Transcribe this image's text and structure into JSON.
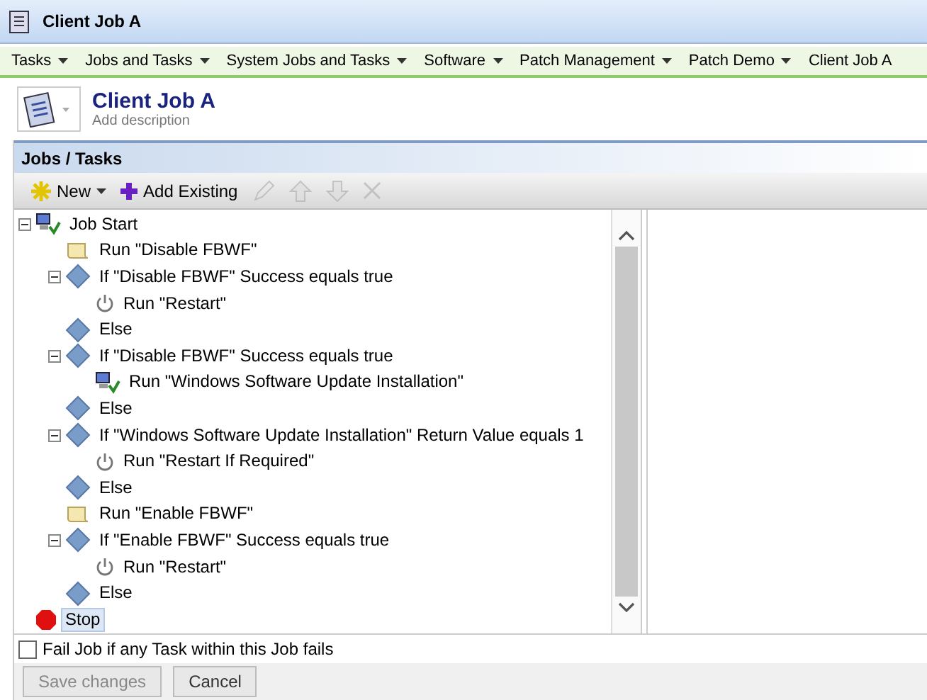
{
  "window": {
    "title": "Client Job A"
  },
  "menu": [
    {
      "label": "Tasks",
      "dropdown": true
    },
    {
      "label": "Jobs and Tasks",
      "dropdown": true
    },
    {
      "label": "System Jobs and Tasks",
      "dropdown": true
    },
    {
      "label": "Software",
      "dropdown": true
    },
    {
      "label": "Patch Management",
      "dropdown": true
    },
    {
      "label": "Patch Demo",
      "dropdown": true
    },
    {
      "label": "Client Job A",
      "dropdown": false
    }
  ],
  "header": {
    "title": "Client Job A",
    "description": "Add description"
  },
  "panel": {
    "title": "Jobs / Tasks"
  },
  "toolbar": [
    {
      "kind": "new",
      "label": "New",
      "disabled": false
    },
    {
      "kind": "add",
      "label": "Add Existing",
      "disabled": false
    },
    {
      "kind": "edit",
      "disabled": true
    },
    {
      "kind": "up",
      "disabled": true
    },
    {
      "kind": "down",
      "disabled": true
    },
    {
      "kind": "delete",
      "disabled": true
    }
  ],
  "tree": [
    {
      "kind": "job",
      "label": "Job Start",
      "selected": false,
      "expanded": true,
      "children": [
        {
          "kind": "script",
          "label": "Run \"Disable FBWF\"",
          "selected": false
        },
        {
          "kind": "condition",
          "label": "If \"Disable FBWF\" Success equals true",
          "selected": false,
          "expanded": true,
          "children": [
            {
              "kind": "power",
              "label": "Run \"Restart\"",
              "selected": false
            }
          ]
        },
        {
          "kind": "condition",
          "label": "Else",
          "selected": false
        },
        {
          "kind": "condition",
          "label": "If \"Disable FBWF\" Success equals true",
          "selected": false,
          "expanded": true,
          "children": [
            {
              "kind": "job",
              "label": "Run \"Windows Software Update Installation\"",
              "selected": false
            }
          ]
        },
        {
          "kind": "condition",
          "label": "Else",
          "selected": false
        },
        {
          "kind": "condition",
          "label": "If \"Windows Software Update Installation\" Return Value equals 1",
          "selected": false,
          "expanded": true,
          "children": [
            {
              "kind": "power",
              "label": "Run \"Restart If Required\"",
              "selected": false
            }
          ]
        },
        {
          "kind": "condition",
          "label": "Else",
          "selected": false
        },
        {
          "kind": "script",
          "label": "Run \"Enable FBWF\"",
          "selected": false
        },
        {
          "kind": "condition",
          "label": "If \"Enable FBWF\" Success equals true",
          "selected": false,
          "expanded": true,
          "children": [
            {
              "kind": "power",
              "label": "Run \"Restart\"",
              "selected": false
            }
          ]
        },
        {
          "kind": "condition",
          "label": "Else",
          "selected": false
        }
      ]
    },
    {
      "kind": "stop",
      "label": "Stop",
      "selected": true
    }
  ],
  "fail_option": {
    "label": "Fail Job if any Task within this Job fails",
    "checked": false
  },
  "buttons": [
    {
      "label": "Save changes",
      "disabled": true
    },
    {
      "label": "Cancel",
      "disabled": false
    }
  ]
}
